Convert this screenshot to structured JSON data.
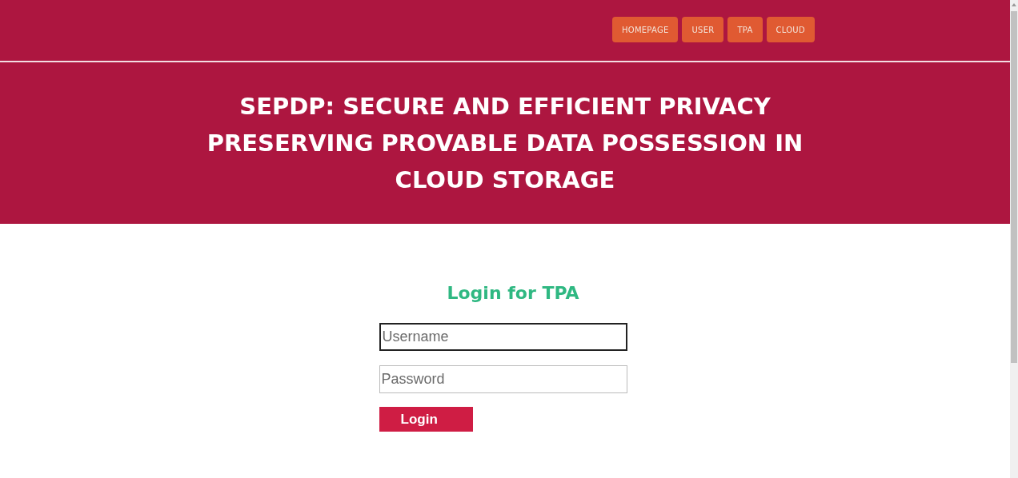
{
  "nav": {
    "items": [
      {
        "label": "HOMEPAGE"
      },
      {
        "label": "USER"
      },
      {
        "label": "TPA"
      },
      {
        "label": "CLOUD"
      }
    ]
  },
  "banner": {
    "title": "SEPDP: SECURE AND EFFICIENT PRIVACY PRESERVING PROVABLE DATA POSSESSION IN CLOUD STORAGE"
  },
  "login": {
    "heading": "Login for TPA",
    "fields": [
      {
        "placeholder": "Username",
        "focused": true
      },
      {
        "placeholder": "Password",
        "focused": false
      }
    ],
    "button": "Login"
  }
}
